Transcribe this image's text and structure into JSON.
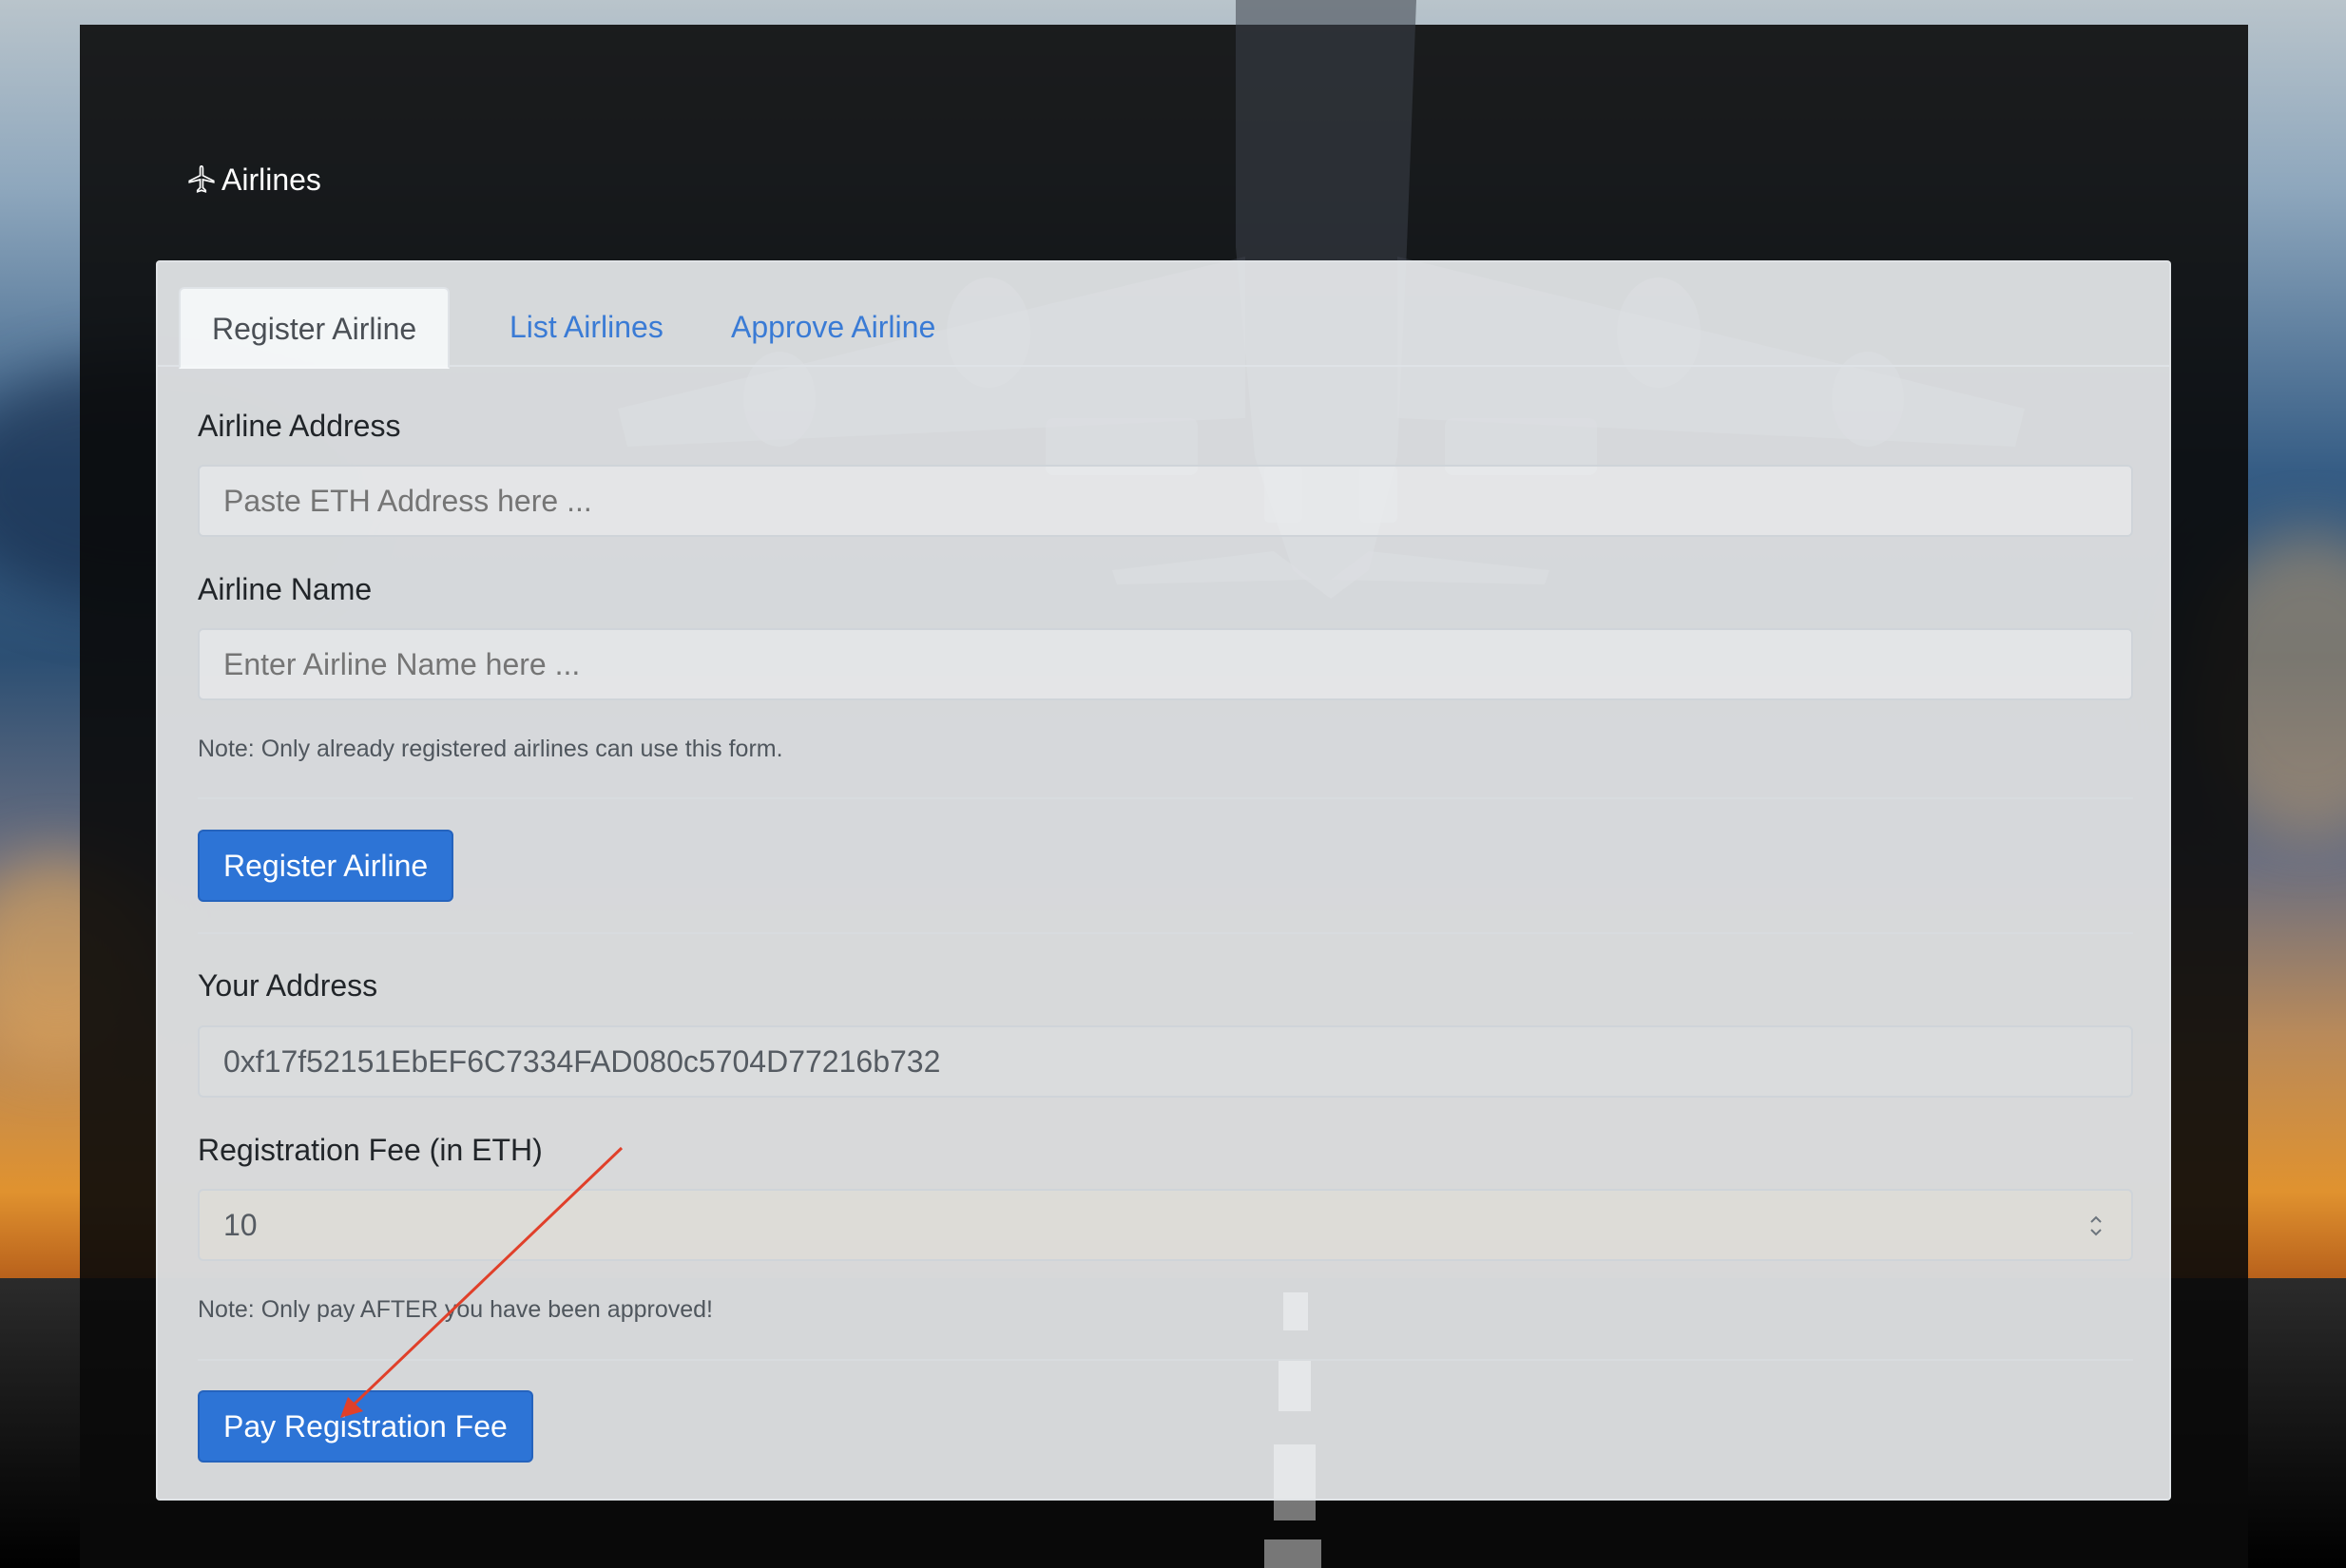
{
  "brand": {
    "icon": "airplane-icon",
    "label": "Airlines"
  },
  "tabs": [
    {
      "label": "Register Airline",
      "active": true
    },
    {
      "label": "List Airlines",
      "active": false
    },
    {
      "label": "Approve Airline",
      "active": false
    }
  ],
  "register_form": {
    "address_label": "Airline Address",
    "address_placeholder": "Paste ETH Address here ...",
    "name_label": "Airline Name",
    "name_placeholder": "Enter Airline Name here ...",
    "note": "Note: Only already registered airlines can use this form.",
    "submit_label": "Register Airline"
  },
  "fee_form": {
    "your_address_label": "Your Address",
    "your_address_value": "0xf17f52151EbEF6C7334FAD080c5704D77216b732",
    "fee_label": "Registration Fee (in ETH)",
    "fee_value": "10",
    "note": "Note: Only pay AFTER you have been approved!",
    "submit_label": "Pay Registration Fee"
  },
  "colors": {
    "primary": "#2d74d6",
    "link": "#3a7bd5",
    "annotation_arrow": "#e0402a"
  }
}
